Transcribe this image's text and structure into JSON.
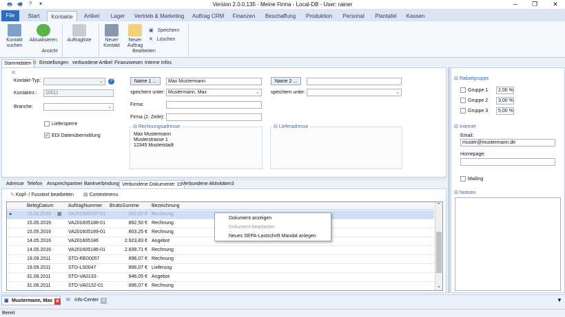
{
  "window": {
    "title": "Version 2.0.0.135 - Meine Firma - Local-DB - User: rainer",
    "minimize": "─",
    "maximize": "❐",
    "close": "✕"
  },
  "ribbon_tabs": [
    "File",
    "Start",
    "Kontakte",
    "Artikel",
    "Lager",
    "Vertrieb & Marketing",
    "Auftrag CRM",
    "Finanzen",
    "Beschaffung",
    "Produktion",
    "Personal",
    "Plantafel",
    "Kassen"
  ],
  "ribbon": {
    "kontakt_suchen": "Kontakt suchen",
    "aktualisieren": "Aktualisieren",
    "auftragliste": "Auftragliste",
    "neuer_kontakt": "Neuer Kontakt",
    "neuer_auftrag": "Neuer Auftrag",
    "speichern": "Speichern",
    "loeschen": "Löschen",
    "group_ansicht": "Ansicht",
    "group_bearbeiten": "Bearbeiten"
  },
  "subtabs": [
    "Stammdaten",
    "Einstellungen",
    "verbundene Artikel",
    "Finanzwesen",
    "Interne Infos"
  ],
  "form": {
    "kontakt_typ_label": "Kontakt-Typ:",
    "kontakt_typ_value": "",
    "kontaktnr_label": "Kontaktnr.:",
    "kontaktnr_value": "10011",
    "branche_label": "Branche:",
    "branche_value": "",
    "liefersperre_label": "Liefersperre",
    "edi_label": "EDI Datenübermittlung",
    "name1_button": "Name 1 ...",
    "name1_value": "Max Mustermann",
    "name2_button": "Name 2 ...",
    "name2_value": "",
    "speichern_unter_label": "speichern unter:",
    "speichern_unter_value": "Mustermann, Max",
    "speichern_unter2_value": "",
    "firma_label": "Firma:",
    "firma_value": "",
    "firma2_label": "Firma (2. Zeile):",
    "firma2_value": "",
    "rechnungsadresse_label": "Rechnungsadresse",
    "rechnungsadresse_lines": [
      "Max Mustermann",
      "Musterstrasse 1",
      "12345 Musterstadt"
    ],
    "lieferadresse_label": "Lieferadresse"
  },
  "right": {
    "rabattgruppe_label": "Rabattgruppe",
    "gruppen": [
      {
        "label": "Gruppe 1",
        "value": "2,00 %"
      },
      {
        "label": "Gruppe 2",
        "value": "3,00 %"
      },
      {
        "label": "Gruppe 3",
        "value": "5,00 %"
      }
    ],
    "internet_label": "Internet",
    "email_label": "Email:",
    "email_value": "muster@mustermann.de",
    "homepage_label": "Homepage:",
    "homepage_value": "",
    "mailing_label": "Mailing",
    "notizen_label": "Notizen"
  },
  "lower_tabs": [
    "Adresse",
    "Telefon",
    "Ansprechpartner",
    "Bankverbindung",
    "Verbundene Dokumente: 19",
    "Verbundene Aktivitäten3"
  ],
  "toolbar": {
    "kopf_fusstext": "Kopf- / Fusstext bearbeiten",
    "contextmenu": "Contextmenu"
  },
  "grid": {
    "columns": [
      "BelegDatum",
      "AuftragNummer",
      "BruttoSumme",
      "Bezeichnung"
    ],
    "rows": [
      [
        "15.05.2016",
        "VA201605187-01",
        "902,02 €",
        "Rechnung"
      ],
      [
        "15.05.2016",
        "VA201605188-01",
        "892,50 €",
        "Rechnung"
      ],
      [
        "15.05.2016",
        "VA201605189-01",
        "803,25 €",
        "Rechnung"
      ],
      [
        "14.05.2016",
        "VA201605186",
        "2.923,83 €",
        "Angebot"
      ],
      [
        "14.05.2016",
        "VA201605186-01",
        "2.839,71 €",
        "Rechnung"
      ],
      [
        "19.09.2011",
        "STD-RE00057",
        "896,07 €",
        "Rechnung"
      ],
      [
        "19.09.2011",
        "STD-LS0047",
        "896,07 €",
        "Lieferung"
      ],
      [
        "31.08.2011",
        "STD-VA0133",
        "946,05 €",
        "Angebot"
      ],
      [
        "31.08.2011",
        "STD-VA0132-01",
        "896,07 €",
        "Rechnung"
      ]
    ]
  },
  "context_menu": [
    "Dokument anzeigen",
    "Dokument bearbeiten",
    "Neues SEPA-Lastschrift Mandat anlegen"
  ],
  "bottom_tabs": [
    "Mustermann, Max",
    "Info-Center"
  ],
  "status": "Bereit"
}
